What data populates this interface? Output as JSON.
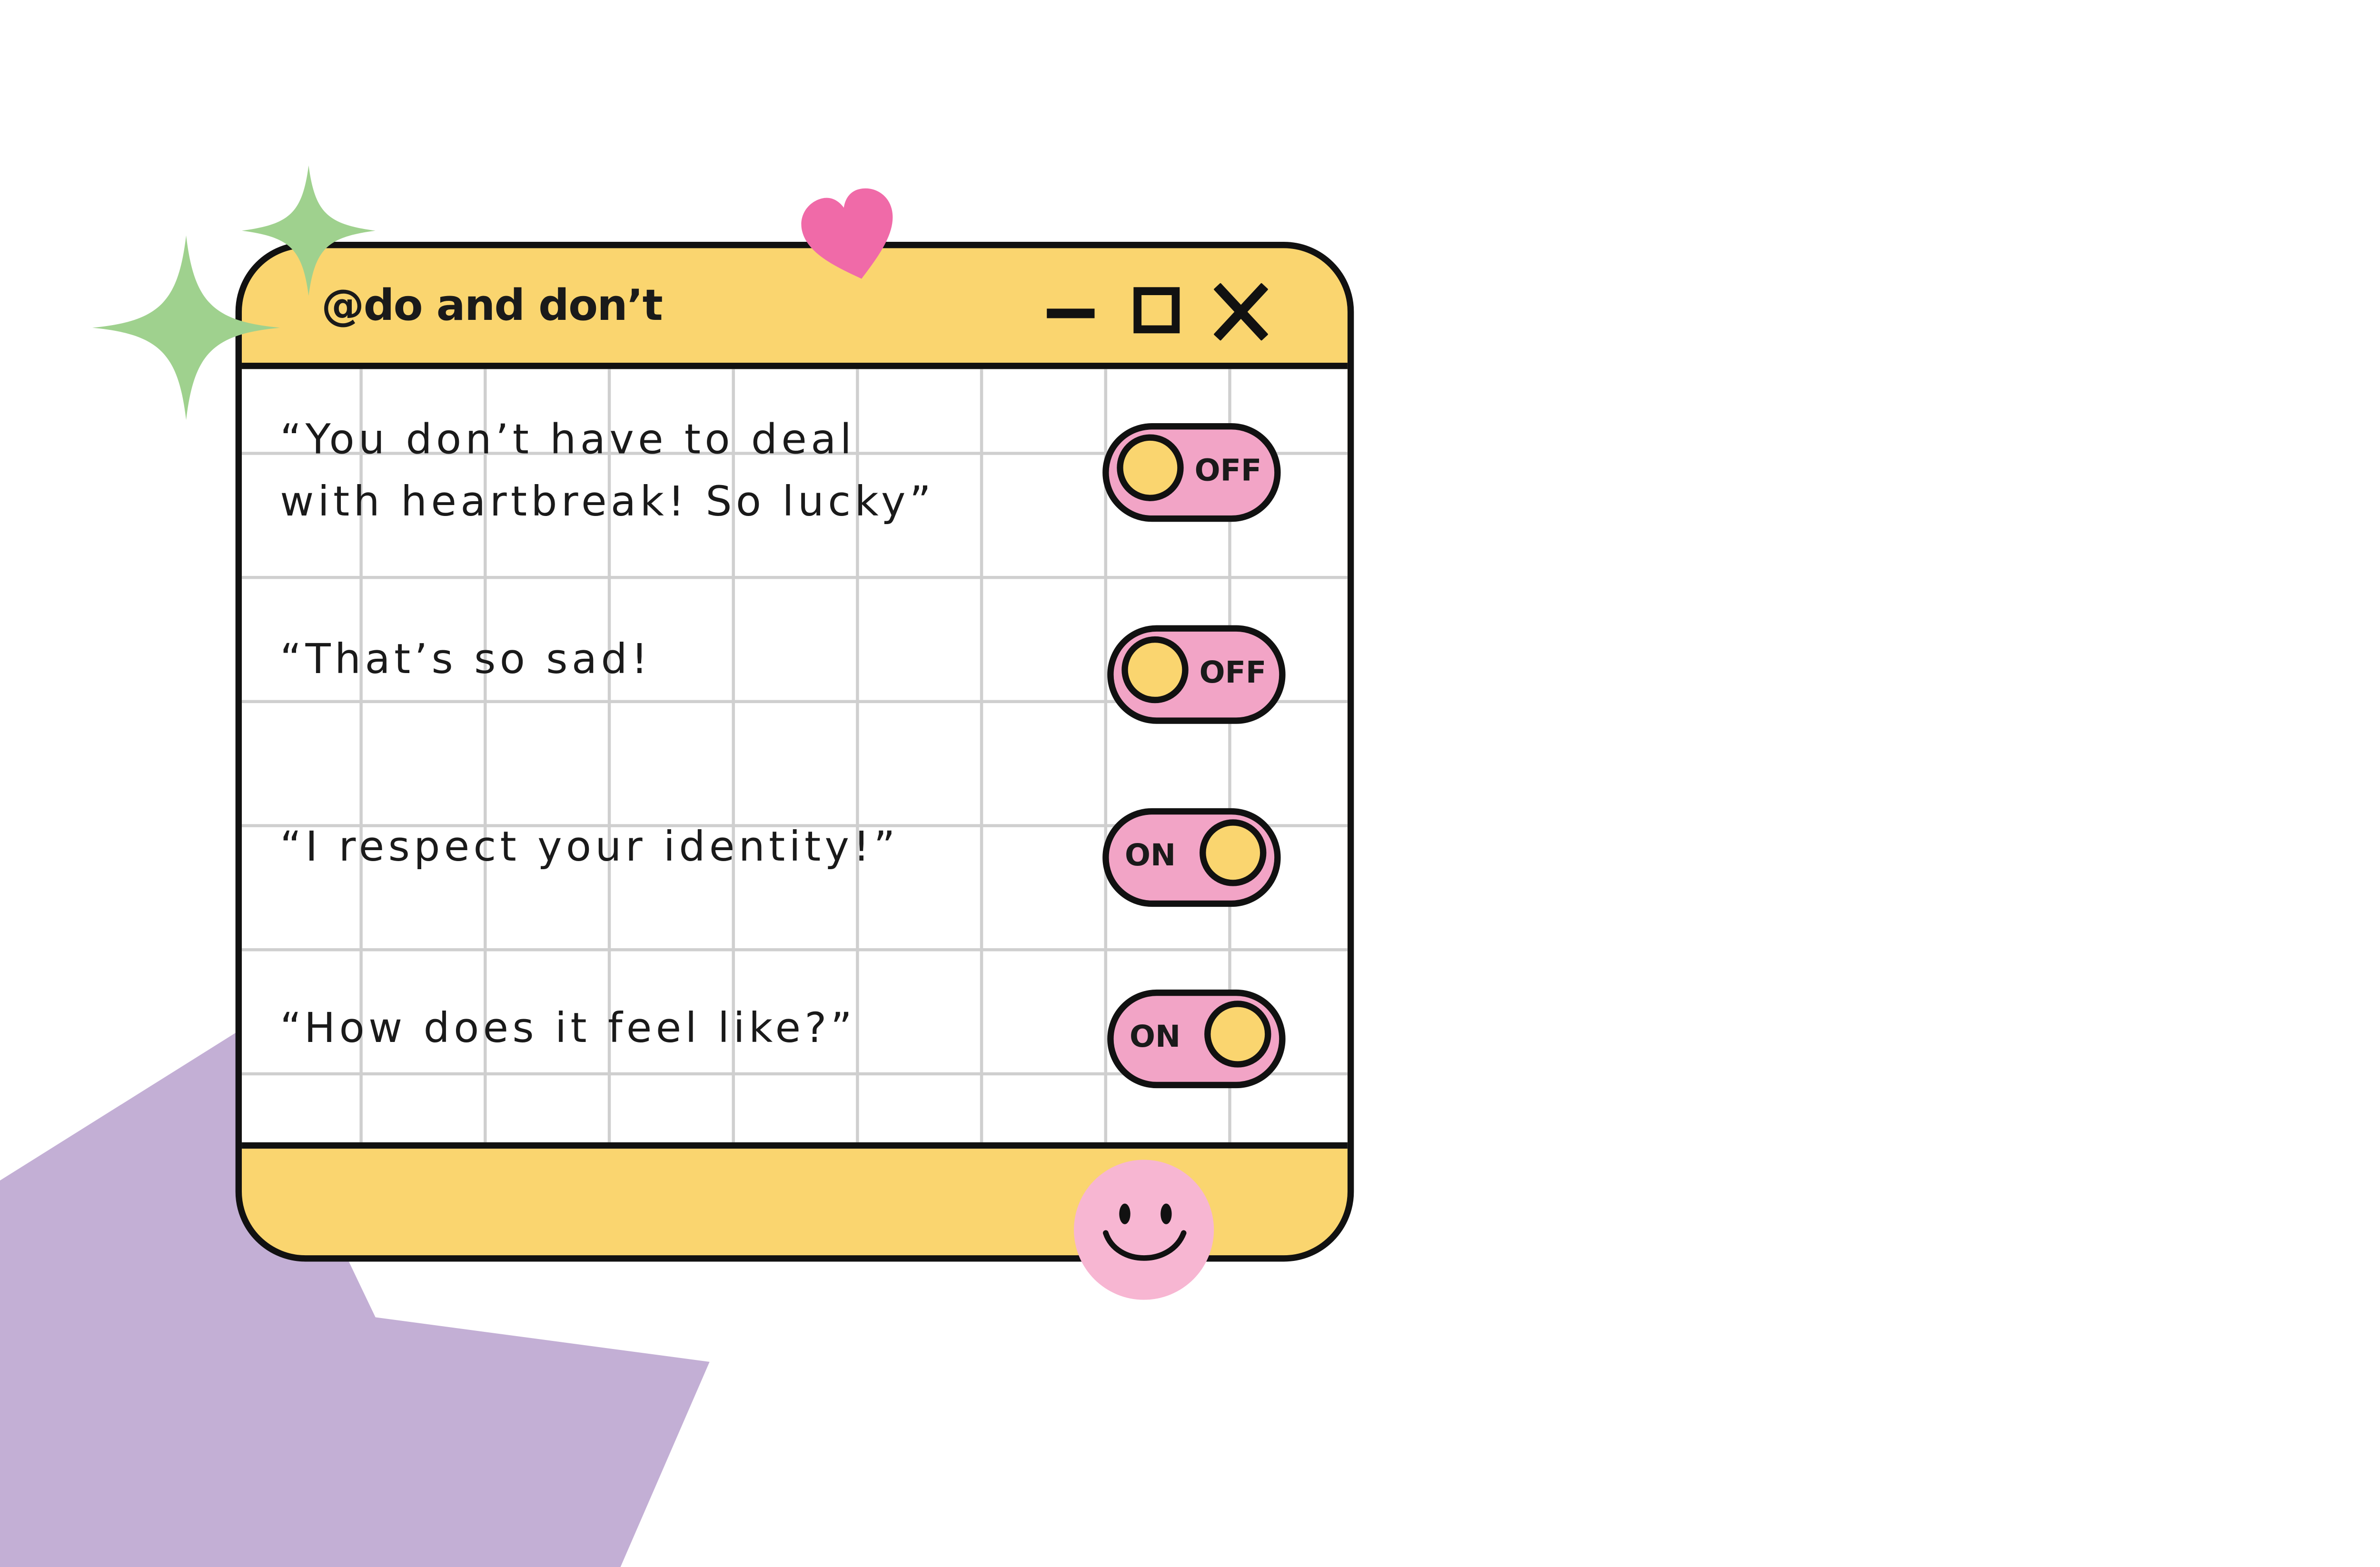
{
  "window": {
    "title": "@do and don’t",
    "controls": {
      "minimize": "minimize-icon",
      "maximize": "maximize-icon",
      "close": "close-icon"
    }
  },
  "rows": [
    {
      "text": "“You don’t have to deal\nwith heartbreak! So lucky”",
      "toggle": "OFF",
      "state": "off"
    },
    {
      "text": "“That’s so sad!",
      "toggle": "OFF",
      "state": "off"
    },
    {
      "text": "“I respect your identity!”",
      "toggle": "ON",
      "state": "on"
    },
    {
      "text": "“How does it feel like?”",
      "toggle": "ON",
      "state": "on"
    }
  ],
  "decorations": {
    "icons": [
      "sparkle-icon",
      "sparkle-icon",
      "heart-icon",
      "smiley-face-icon"
    ]
  },
  "colors": {
    "window_yellow": "#fad56f",
    "toggle_pink": "#f2a4c6",
    "heart_pink": "#f06aa8",
    "smiley_pink": "#f7b6d2",
    "sparkle_green": "#9fd18e",
    "background_purple": "#c3afd5",
    "outline": "#111111",
    "grid_line": "#cfcfcf"
  }
}
